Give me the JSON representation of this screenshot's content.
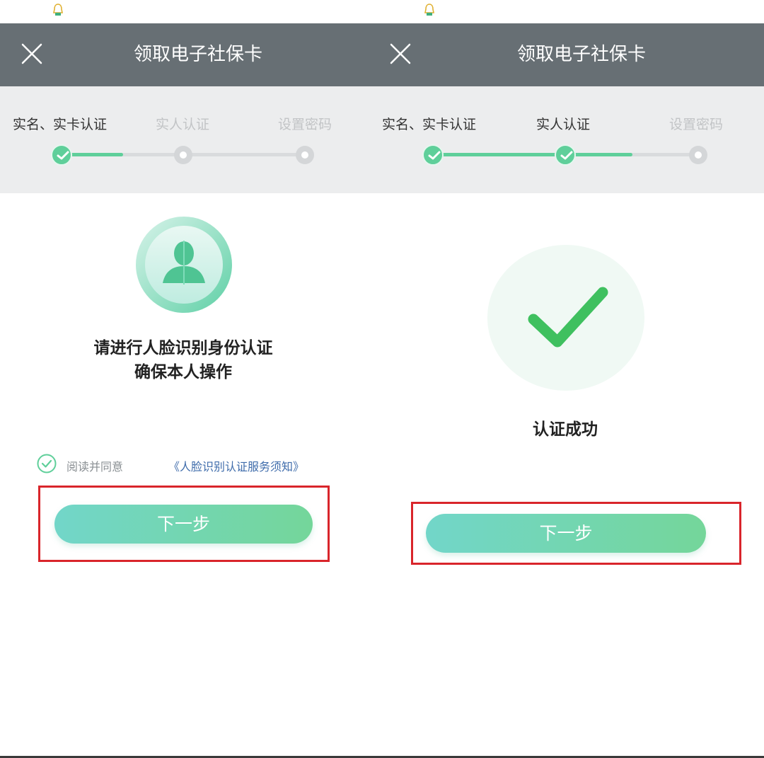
{
  "left_screen": {
    "header": {
      "title": "领取电子社保卡",
      "close_icon": "close-icon"
    },
    "steps": [
      {
        "label": "实名、实卡认证",
        "status": "done"
      },
      {
        "label": "实人认证",
        "status": "todo"
      },
      {
        "label": "设置密码",
        "status": "todo"
      }
    ],
    "illustration_icon": "face-recognition-icon",
    "heading_line1": "请进行人脸识别身份认证",
    "heading_line2": "确保本人操作",
    "agreement": {
      "prefix": "阅读并同意",
      "link": "《人脸识别认证服务须知》",
      "checked": true
    },
    "next_button": "下一步"
  },
  "right_screen": {
    "header": {
      "title": "领取电子社保卡",
      "close_icon": "close-icon"
    },
    "steps": [
      {
        "label": "实名、实卡认证",
        "status": "done"
      },
      {
        "label": "实人认证",
        "status": "done"
      },
      {
        "label": "设置密码",
        "status": "todo"
      }
    ],
    "success_icon": "checkmark-icon",
    "success_text": "认证成功",
    "next_button": "下一步"
  },
  "colors": {
    "header_bg": "#676f74",
    "step_green": "#5fcf9a",
    "button_gradient_start": "#72d6c9",
    "button_gradient_end": "#74d69a",
    "highlight_red": "#d9252b",
    "link_blue": "#3f6cab"
  }
}
